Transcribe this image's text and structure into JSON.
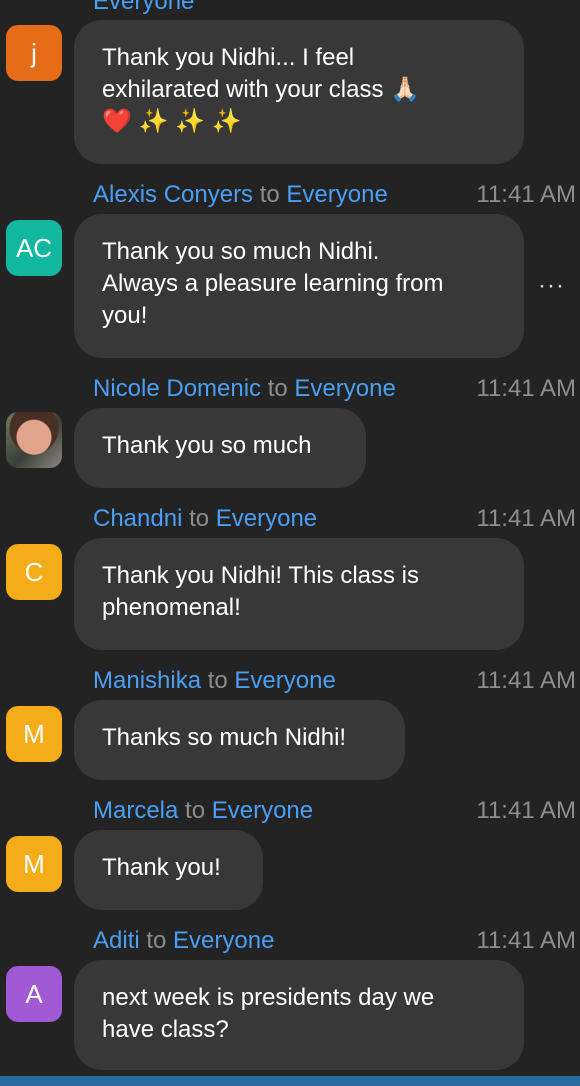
{
  "chat": {
    "top_partial_text": "Everyone",
    "messages": [
      {
        "avatar_text": "j",
        "avatar_color": "#e56d18",
        "text": "Thank you Nidhi... I feel\nexhilarated with your class 🙏🏻\n❤️ ✨ ✨ ✨"
      },
      {
        "sender": "Alexis Conyers",
        "to_label": "to",
        "recipient": "Everyone",
        "time": "11:41 AM",
        "avatar_text": "AC",
        "avatar_color": "#11b79f",
        "text": "Thank you so much Nidhi.\nAlways a pleasure learning from\nyou!",
        "more_icon": "···"
      },
      {
        "sender": "Nicole Domenic",
        "to_label": "to",
        "recipient": "Everyone",
        "time": "11:41 AM",
        "text": "Thank you so much"
      },
      {
        "sender": "Chandni",
        "to_label": "to",
        "recipient": "Everyone",
        "time": "11:41 AM",
        "avatar_text": "C",
        "avatar_color": "#f4ad18",
        "text": "Thank you Nidhi! This class is\nphenomenal!"
      },
      {
        "sender": "Manishika",
        "to_label": "to",
        "recipient": "Everyone",
        "time": "11:41 AM",
        "avatar_text": "M",
        "avatar_color": "#f4ad18",
        "text": "Thanks so much Nidhi!"
      },
      {
        "sender": "Marcela",
        "to_label": "to",
        "recipient": "Everyone",
        "time": "11:41 AM",
        "avatar_text": "M",
        "avatar_color": "#f4ad18",
        "text": "Thank you!"
      },
      {
        "sender": "Aditi",
        "to_label": "to",
        "recipient": "Everyone",
        "time": "11:41 AM",
        "avatar_text": "A",
        "avatar_color": "#a259d4",
        "text": "next week is presidents day we\nhave class?"
      }
    ],
    "colors": {
      "background": "#232323",
      "bubble": "#383838",
      "name": "#4a9ff5",
      "meta": "#8e8e8e",
      "bottom_bar": "#2b6a9e"
    }
  }
}
